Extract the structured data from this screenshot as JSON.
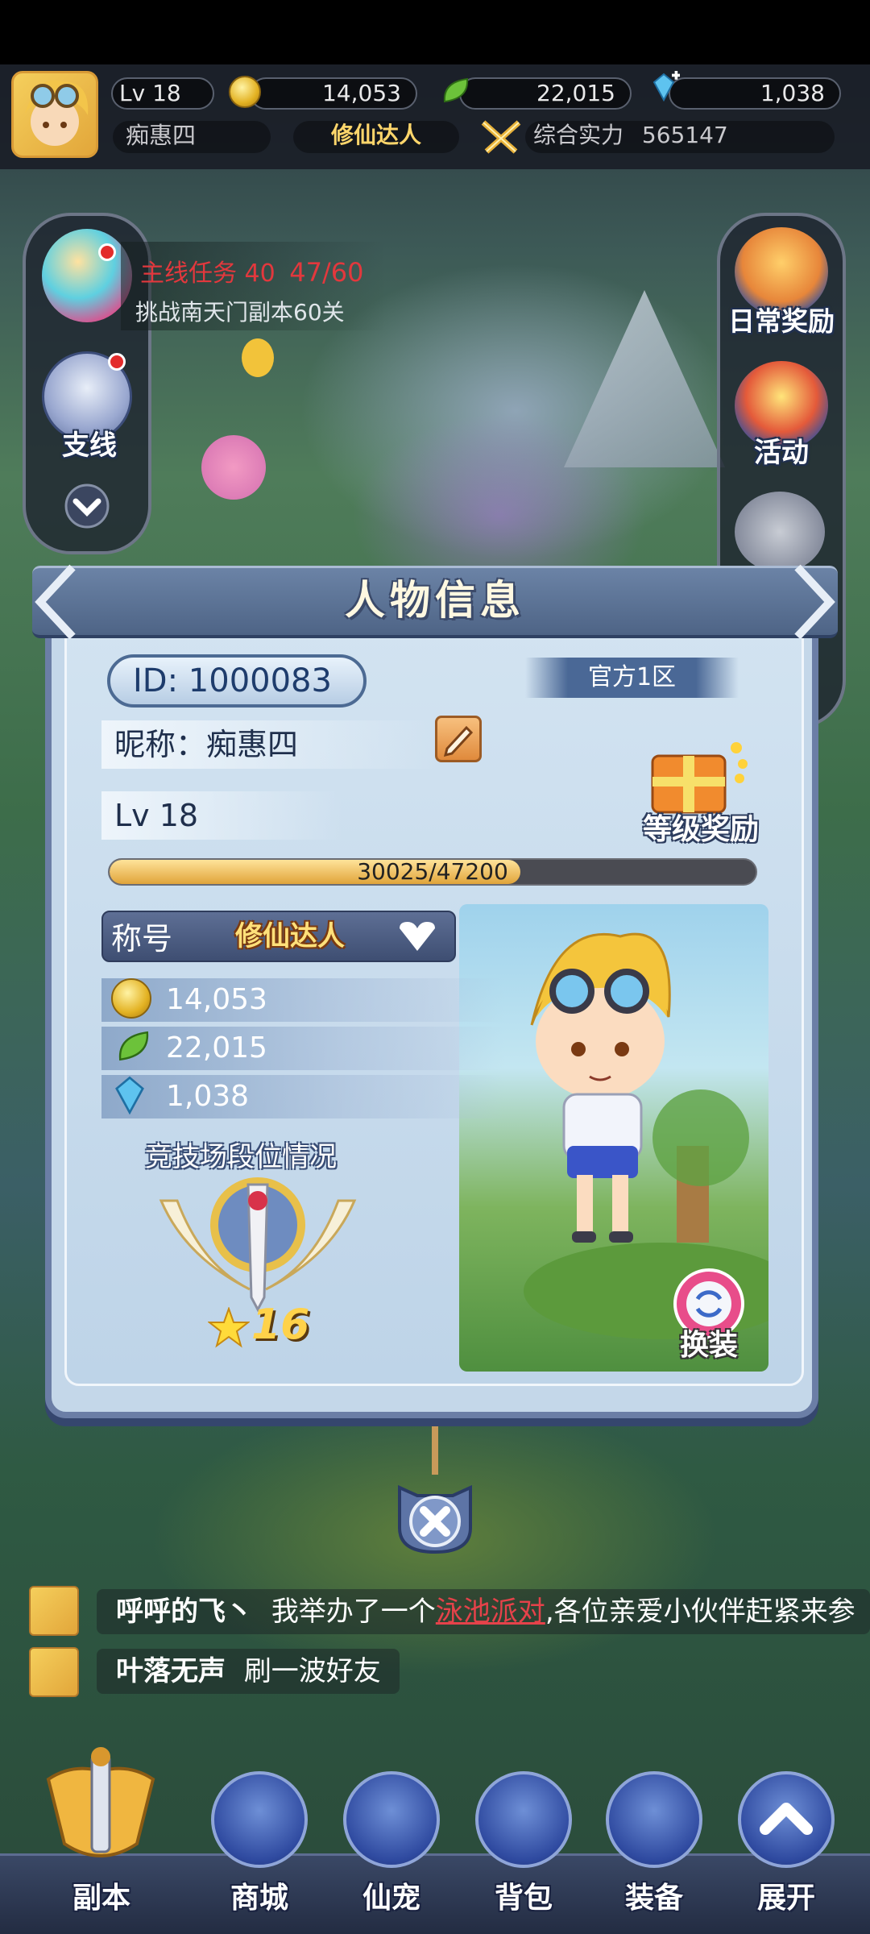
{
  "colors": {
    "accent": "#e0a43a",
    "dialog_bg": "#c4d7e9",
    "title_gold": "#ffe07a",
    "task_red": "#e2383d"
  },
  "topbar": {
    "level": "Lv 18",
    "gold": "14,053",
    "leaf": "22,015",
    "gems": "1,038",
    "player_name": "痴惠四",
    "title_badge": "修仙达人",
    "power_label": "综合实力",
    "power_value": "565147"
  },
  "quest": {
    "title": "主线任务 40",
    "progress": "47/60",
    "desc": "挑战南天门副本60关"
  },
  "left_panel": {
    "branch_label": "支线"
  },
  "right_panel": {
    "daily_label": "日常奖励",
    "activity_label": "活动"
  },
  "dialog": {
    "title": "人物信息",
    "id": "ID: 1000083",
    "server": "官方1区",
    "nickname": "昵称：痴惠四",
    "level": "Lv 18",
    "exp_text": "30025/47200",
    "exp_fraction": 0.636,
    "level_reward": "等级奖励",
    "title_label": "称号",
    "title_value": "修仙达人",
    "gold": "14,053",
    "leaf": "22,015",
    "gems": "1,038",
    "arena_label": "竞技场段位情况",
    "arena_stars": "16",
    "change_outfit": "换装"
  },
  "chat": [
    {
      "name": "呼呼的飞丶",
      "text": "我举办了一个",
      "link": "泳池派对",
      "tail": ",各位亲爱小伙伴赶紧来参"
    },
    {
      "name": "叶落无声",
      "text": "刷一波好友",
      "link": "",
      "tail": ""
    }
  ],
  "bottom_nav": [
    {
      "label": "副本",
      "icon": "sword-shield-icon"
    },
    {
      "label": "商城",
      "icon": "shop-icon"
    },
    {
      "label": "仙宠",
      "icon": "pet-icon"
    },
    {
      "label": "背包",
      "icon": "bag-icon"
    },
    {
      "label": "装备",
      "icon": "hammer-icon"
    },
    {
      "label": "展开",
      "icon": "chevron-up-icon"
    }
  ]
}
